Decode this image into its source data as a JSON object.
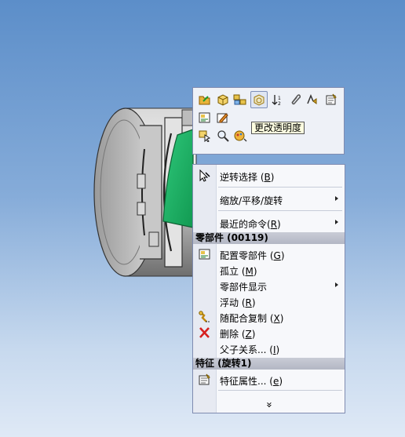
{
  "toolbar": {
    "row1": [
      {
        "name": "open-part-icon",
        "highlight": false
      },
      {
        "name": "edit-part-icon",
        "highlight": false
      },
      {
        "name": "hide-components-icon",
        "highlight": false
      },
      {
        "name": "change-transparency-icon",
        "highlight": true
      },
      {
        "name": "sort-icon",
        "highlight": false
      },
      {
        "name": "paperclip-icon",
        "highlight": false
      },
      {
        "name": "mates-icon",
        "highlight": false
      },
      {
        "name": "properties-icon",
        "highlight": false
      }
    ],
    "row2": [
      {
        "name": "component-config-icon",
        "highlight": false
      },
      {
        "name": "edit-sketch-icon",
        "highlight": false
      }
    ],
    "row3": [
      {
        "name": "select-other-icon",
        "highlight": false
      },
      {
        "name": "zoom-to-selection-icon",
        "highlight": false
      },
      {
        "name": "appearance-icon",
        "highlight": false
      }
    ],
    "tooltip": "更改透明度"
  },
  "menu": {
    "invert_selection": {
      "text": "逆转选择 (",
      "key": "B",
      "end": ")"
    },
    "zoom_pan_rotate": "缩放/平移/旋转",
    "recent_commands": {
      "text": "最近的命令(",
      "key": "R",
      "end": ")"
    },
    "section_part": "零部件 (00119)",
    "configure_component": {
      "text": "配置零部件 (",
      "key": "G",
      "end": ")"
    },
    "isolate": {
      "text": "孤立 (",
      "key": "M",
      "end": ")"
    },
    "component_display": "零部件显示",
    "float": {
      "text": "浮动 (",
      "key": "R",
      "end": ")"
    },
    "copy_with_mates": {
      "text": "随配合复制 (",
      "key": "X",
      "end": ")"
    },
    "delete": {
      "text": "删除 (",
      "key": "Z",
      "end": ")"
    },
    "parent_child": {
      "text": "父子关系... (",
      "key": "I",
      "end": ")"
    },
    "section_feature": "特征 (旋转1)",
    "feature_properties": {
      "text": "特征属性... (",
      "key": "e",
      "end": ")"
    },
    "expand": "»"
  }
}
